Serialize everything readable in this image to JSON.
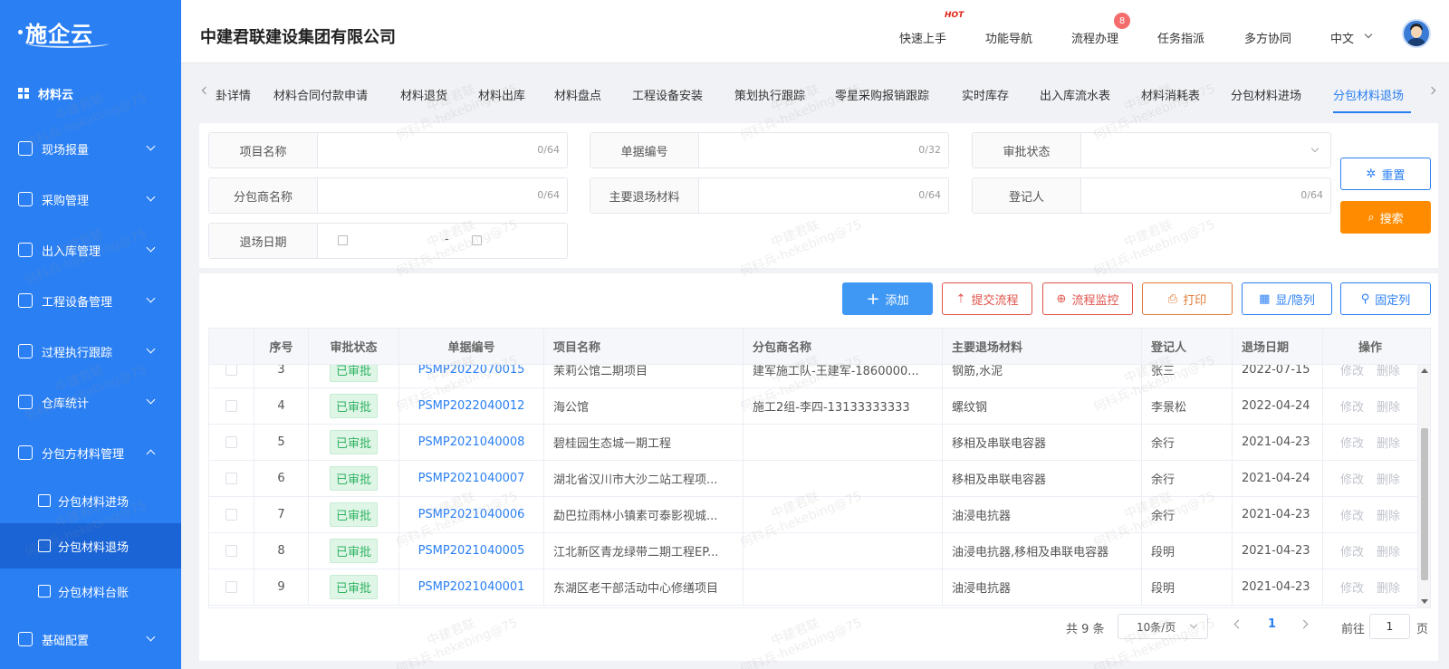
{
  "app": {
    "logo": "施企云",
    "company": "中建君联建设集团有限公司"
  },
  "header": {
    "nav": [
      "快速上手",
      "功能导航",
      "流程办理",
      "任务指派",
      "多方协同"
    ],
    "hot_tag": "HOT",
    "badge": "8",
    "language": "中文"
  },
  "sidebar": {
    "title": "材料云",
    "items": [
      {
        "label": "现场报量",
        "icon": "report-icon"
      },
      {
        "label": "采购管理",
        "icon": "purchase-icon"
      },
      {
        "label": "出入库管理",
        "icon": "warehouse-icon"
      },
      {
        "label": "工程设备管理",
        "icon": "equipment-icon"
      },
      {
        "label": "过程执行跟踪",
        "icon": "tracking-icon"
      },
      {
        "label": "仓库统计",
        "icon": "statistics-icon"
      },
      {
        "label": "分包方材料管理",
        "icon": "subcontract-icon"
      }
    ],
    "sub_items": [
      "分包材料进场",
      "分包材料退场",
      "分包材料台账"
    ],
    "last_item": "基础配置"
  },
  "tabs": [
    "卦详情",
    "材料合同付款申请",
    "材料退货",
    "材料出库",
    "材料盘点",
    "工程设备安装",
    "策划执行跟踪",
    "零星采购报销跟踪",
    "实时库存",
    "出入库流水表",
    "材料消耗表",
    "分包材料进场",
    "分包材料退场"
  ],
  "filters": {
    "project_name": {
      "label": "项目名称",
      "count": "0/64"
    },
    "doc_no": {
      "label": "单据编号",
      "count": "0/32"
    },
    "approval_status": {
      "label": "审批状态"
    },
    "sub_name": {
      "label": "分包商名称",
      "count": "0/64"
    },
    "main_material": {
      "label": "主要退场材料",
      "count": "0/64"
    },
    "registrar": {
      "label": "登记人",
      "count": "0/64"
    },
    "exit_date": {
      "label": "退场日期",
      "sep": "-"
    },
    "reset": "重置",
    "search": "搜索"
  },
  "actions": {
    "add": "添加",
    "submit": "提交流程",
    "monitor": "流程监控",
    "print": "打印",
    "toggle_cols": "显/隐列",
    "fix_cols": "固定列"
  },
  "table": {
    "headers": [
      "序号",
      "审批状态",
      "单据编号",
      "项目名称",
      "分包商名称",
      "主要退场材料",
      "登记人",
      "退场日期",
      "操作"
    ],
    "rows": [
      [
        "3",
        "已审批",
        "PSMP2022070015",
        "茉莉公馆二期项目",
        "建军施工队-王建军-1860000...",
        "钢筋,水泥",
        "张三",
        "2022-07-15"
      ],
      [
        "4",
        "已审批",
        "PSMP2022040012",
        "海公馆",
        "施工2组-李四-13133333333",
        "螺纹钢",
        "李景松",
        "2022-04-24"
      ],
      [
        "5",
        "已审批",
        "PSMP2021040008",
        "碧桂园生态城一期工程",
        "",
        "移相及串联电容器",
        "余行",
        "2021-04-23"
      ],
      [
        "6",
        "已审批",
        "PSMP2021040007",
        "湖北省汉川市大沙二站工程项...",
        "",
        "移相及串联电容器",
        "余行",
        "2021-04-24"
      ],
      [
        "7",
        "已审批",
        "PSMP2021040006",
        "勐巴拉雨林小镇素可泰影视城...",
        "",
        "油浸电抗器",
        "余行",
        "2021-04-23"
      ],
      [
        "8",
        "已审批",
        "PSMP2021040005",
        "江北新区青龙绿带二期工程EP...",
        "",
        "油浸电抗器,移相及串联电容器",
        "段明",
        "2021-04-23"
      ],
      [
        "9",
        "已审批",
        "PSMP2021040001",
        "东湖区老干部活动中心修缮项目",
        "",
        "油浸电抗器",
        "段明",
        "2021-04-23"
      ]
    ],
    "op_edit": "修改",
    "op_delete": "删除"
  },
  "pagination": {
    "total": "共 9 条",
    "page_size": "10条/页",
    "current": "1",
    "goto": "前往",
    "goto_value": "1",
    "page_unit": "页"
  },
  "watermark": {
    "line1": "中建君联",
    "line2": "何科兵-hekebing@75"
  },
  "colors": {
    "primary": "#2a7ff3",
    "orange": "#ff8c00",
    "red": "#e0534b",
    "success": "#2fb463"
  }
}
